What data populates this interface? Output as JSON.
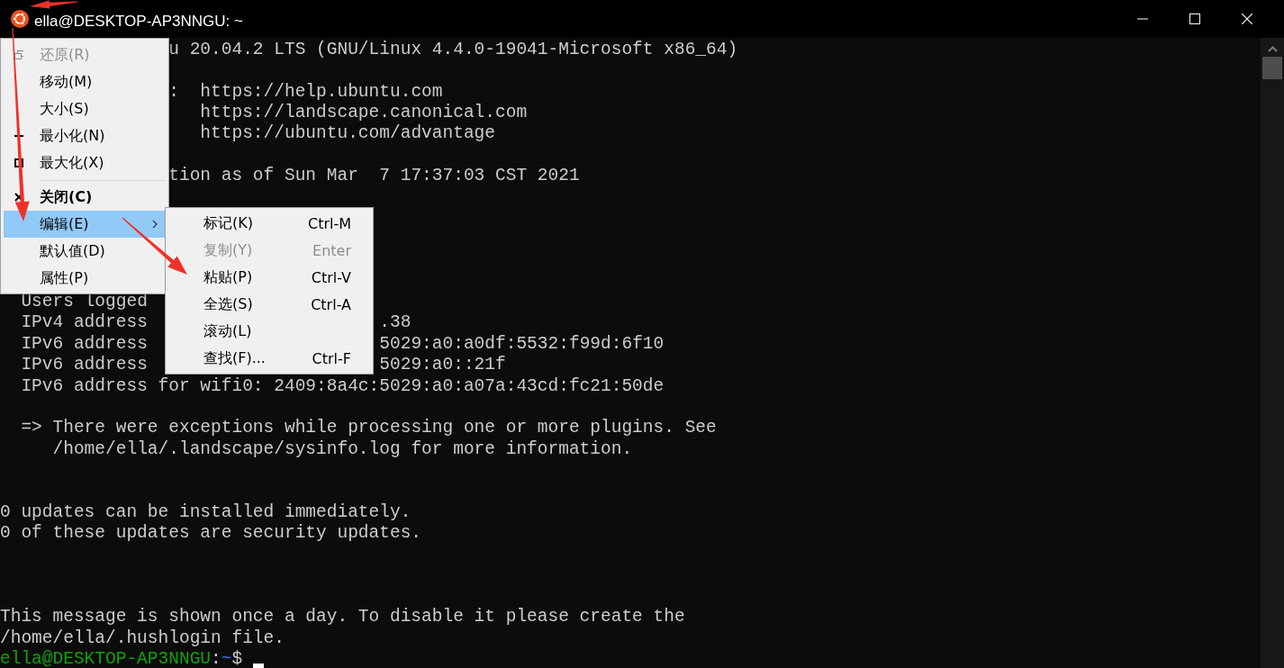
{
  "window": {
    "title": "ella@DESKTOP-AP3NNGU: ~"
  },
  "terminal": {
    "lines": [
      {
        "kind": "text",
        "segments": [
          "                u 20.04.2 LTS (GNU/Linux 4.4.0-19041-Microsoft x86_64)"
        ]
      },
      {
        "kind": "blank"
      },
      {
        "kind": "text",
        "segments": [
          "                :  https://help.ubuntu.com"
        ]
      },
      {
        "kind": "text",
        "segments": [
          "                   https://landscape.canonical.com"
        ]
      },
      {
        "kind": "text",
        "segments": [
          "                   https://ubuntu.com/advantage"
        ]
      },
      {
        "kind": "blank"
      },
      {
        "kind": "text",
        "segments": [
          "                tion as of Sun Mar  7 17:37:03 CST 2021"
        ]
      },
      {
        "kind": "blank"
      },
      {
        "kind": "blank"
      },
      {
        "kind": "blank"
      },
      {
        "kind": "blank"
      },
      {
        "kind": "blank"
      },
      {
        "kind": "text",
        "segments": [
          "  Users logged"
        ]
      },
      {
        "kind": "text",
        "segments": [
          "  IPv4 address",
          "                      .38"
        ]
      },
      {
        "kind": "text",
        "segments": [
          "  IPv6 address",
          "                      5029:a0:a0df:5532:f99d:6f10"
        ]
      },
      {
        "kind": "text",
        "segments": [
          "  IPv6 address",
          "                      5029:a0::21f"
        ]
      },
      {
        "kind": "text",
        "segments": [
          "  IPv6 address for wifi0: 2409:8a4c:5029:a0:a07a:43cd:fc21:50de"
        ]
      },
      {
        "kind": "blank"
      },
      {
        "kind": "text",
        "segments": [
          "  => There were exceptions while processing one or more plugins. See"
        ]
      },
      {
        "kind": "text",
        "segments": [
          "     /home/ella/.landscape/sysinfo.log for more information."
        ]
      },
      {
        "kind": "blank"
      },
      {
        "kind": "blank"
      },
      {
        "kind": "text",
        "segments": [
          "0 updates can be installed immediately."
        ]
      },
      {
        "kind": "text",
        "segments": [
          "0 of these updates are security updates."
        ]
      },
      {
        "kind": "blank"
      },
      {
        "kind": "blank"
      },
      {
        "kind": "blank"
      },
      {
        "kind": "text",
        "segments": [
          "This message is shown once a day. To disable it please create the"
        ]
      },
      {
        "kind": "text",
        "segments": [
          "/home/ella/.hushlogin file."
        ]
      },
      {
        "kind": "prompt",
        "user_host": "ella@DESKTOP-AP3NNGU",
        "separator": ":",
        "path": "~",
        "symbol": "$"
      }
    ]
  },
  "system_menu": {
    "items": [
      {
        "kind": "command",
        "label": "还原(R)",
        "disabled": true,
        "selected": false,
        "default": false
      },
      {
        "kind": "command",
        "label": "移动(M)",
        "disabled": false,
        "selected": false,
        "default": false
      },
      {
        "kind": "command",
        "label": "大小(S)",
        "disabled": false,
        "selected": false,
        "default": false
      },
      {
        "kind": "command",
        "label": "最小化(N)",
        "disabled": false,
        "selected": false,
        "default": false
      },
      {
        "kind": "command",
        "label": "最大化(X)",
        "disabled": false,
        "selected": false,
        "default": false
      },
      {
        "kind": "separator"
      },
      {
        "kind": "command",
        "label": "关闭(C)",
        "disabled": false,
        "selected": false,
        "default": true
      },
      {
        "kind": "submenu",
        "label": "编辑(E)",
        "disabled": false,
        "selected": true,
        "default": false,
        "children": [
          {
            "label": "标记(K)",
            "shortcut": "Ctrl-M",
            "disabled": false,
            "selected": false
          },
          {
            "label": "复制(Y)",
            "shortcut": "Enter",
            "disabled": true,
            "selected": false
          },
          {
            "label": "粘贴(P)",
            "shortcut": "Ctrl-V",
            "disabled": false,
            "selected": false
          },
          {
            "label": "全选(S)",
            "shortcut": "Ctrl-A",
            "disabled": false,
            "selected": false
          },
          {
            "label": "滚动(L)",
            "disabled": false,
            "selected": false
          },
          {
            "label": "查找(F)...",
            "shortcut": "Ctrl-F",
            "disabled": false,
            "selected": false
          }
        ]
      },
      {
        "kind": "command",
        "label": "默认值(D)",
        "disabled": false,
        "selected": false,
        "default": false
      },
      {
        "kind": "command",
        "label": "属性(P)",
        "disabled": false,
        "selected": false,
        "default": false
      }
    ]
  }
}
